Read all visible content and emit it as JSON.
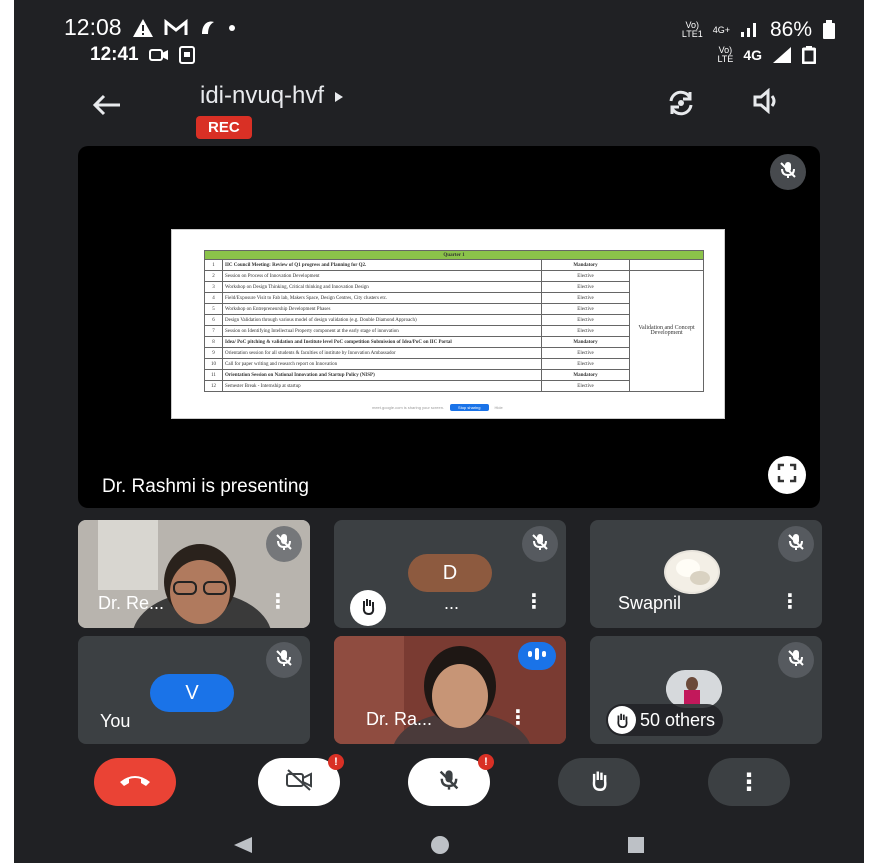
{
  "status_bar": {
    "time1": "12:08",
    "battery": "86%",
    "net1": "4G+",
    "time2": "12:41",
    "net2": "4G",
    "volte1_top": "Vo)",
    "volte1_bottom": "LTE1",
    "volte2_top": "Vo)",
    "volte2_bottom": "LTE"
  },
  "header": {
    "meeting_code": "idi-nvuq-hvf",
    "rec_label": "REC"
  },
  "presentation": {
    "presenter_text": "Dr. Rashmi is presenting",
    "slide": {
      "header": "Quarter 1",
      "rows": [
        {
          "num": "1",
          "title": "IIC Council Meeting: Review of Q1 progress and Planning for Q2.",
          "category": "Mandatory"
        },
        {
          "num": "2",
          "title": "Session on Process of Innovation Development",
          "category": "Elective"
        },
        {
          "num": "3",
          "title": "Workshop on Design Thinking, Critical thinking and Innovation Design",
          "category": "Elective"
        },
        {
          "num": "4",
          "title": "Field/Exposure Visit to Fab lab, Makers Space, Design Centres, City clusters etc.",
          "category": "Elective"
        },
        {
          "num": "5",
          "title": "Workshop on Entrepreneurship Development Phases",
          "category": "Elective"
        },
        {
          "num": "6",
          "title": "Design Validation through various model of design validation (e.g. Double Diamond Approach)",
          "category": "Elective"
        },
        {
          "num": "7",
          "title": "Session on Identifying Intellectual Property component at the early stage of innovation",
          "category": "Elective"
        },
        {
          "num": "8",
          "title": "Idea/ PoC pitching & validation and Institute level PoC competition Submission of Idea/PoC on IIC Portal",
          "category": "Mandatory"
        },
        {
          "num": "9",
          "title": "Orientation session for all students & faculties of institute by Innovation Ambassador",
          "category": "Elective"
        },
        {
          "num": "10",
          "title": "Call for paper writing and research report on Innovation",
          "category": "Elective"
        },
        {
          "num": "11",
          "title": "Orientation Session on National Innovation and Startup Policy (NISP)",
          "category": "Mandatory"
        },
        {
          "num": "12",
          "title": "Semester Break - Internship at startup",
          "category": "Elective"
        }
      ],
      "side_label": "Validation and Concept Development",
      "share_text": "meet.google.com is sharing your screen.",
      "stop_label": "Stop sharing",
      "hide_label": "Hide"
    }
  },
  "participants": [
    {
      "name": "Dr. Re...",
      "type": "video"
    },
    {
      "name": "...",
      "initial": "D",
      "avatar_color": "#8d5a3f"
    },
    {
      "name": "Swapnil",
      "type": "photo"
    },
    {
      "name": "You",
      "initial": "V",
      "avatar_color": "#1a73e8"
    },
    {
      "name": "Dr. Ra...",
      "type": "video"
    },
    {
      "name": "50 others",
      "type": "group"
    }
  ],
  "controls": {
    "end_call_color": "#ea4335",
    "icons": [
      "end-call-icon",
      "camera-off-icon",
      "mic-off-icon",
      "raise-hand-icon",
      "more-options-icon"
    ],
    "camera_badge": "!",
    "mic_badge": "!"
  }
}
